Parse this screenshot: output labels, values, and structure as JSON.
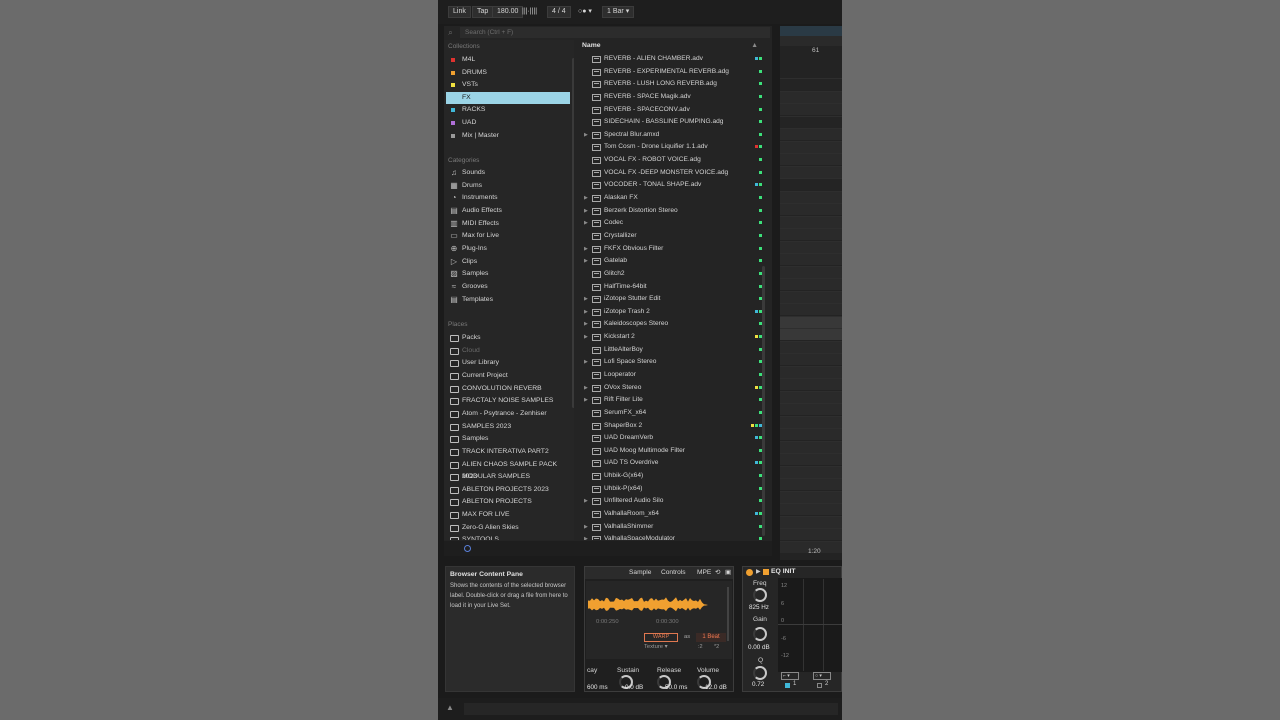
{
  "transport": {
    "link": "Link",
    "tap": "Tap",
    "tempo": "180.00",
    "time_sig": "4 / 4",
    "quantize": "1 Bar"
  },
  "browser": {
    "search_placeholder": "Search (Ctrl + F)",
    "collections_title": "Collections",
    "collections": [
      {
        "label": "M4L",
        "color": "#e0322f"
      },
      {
        "label": "DRUMS",
        "color": "#f0a030"
      },
      {
        "label": "VSTs",
        "color": "#f0e040"
      },
      {
        "label": "FX",
        "color": "#9bd4e6",
        "selected": true
      },
      {
        "label": "RACKS",
        "color": "#40b8d8"
      },
      {
        "label": "UAD",
        "color": "#b070d8"
      },
      {
        "label": "Mix | Master",
        "color": "#9a9a9a"
      }
    ],
    "categories_title": "Categories",
    "categories": [
      {
        "label": "Sounds",
        "icon": "music-note-icon",
        "glyph": "♫"
      },
      {
        "label": "Drums",
        "icon": "drum-grid-icon",
        "glyph": "▦"
      },
      {
        "label": "Instruments",
        "icon": "clock-icon",
        "glyph": "◔"
      },
      {
        "label": "Audio Effects",
        "icon": "audio-effects-icon",
        "glyph": "▤"
      },
      {
        "label": "MIDI Effects",
        "icon": "midi-effects-icon",
        "glyph": "▥"
      },
      {
        "label": "Max for Live",
        "icon": "max-for-live-icon",
        "glyph": "▭"
      },
      {
        "label": "Plug-Ins",
        "icon": "plugin-icon",
        "glyph": "⊕"
      },
      {
        "label": "Clips",
        "icon": "clip-icon",
        "glyph": "▷"
      },
      {
        "label": "Samples",
        "icon": "samples-icon",
        "glyph": "▨"
      },
      {
        "label": "Grooves",
        "icon": "grooves-icon",
        "glyph": "≈"
      },
      {
        "label": "Templates",
        "icon": "templates-icon",
        "glyph": "▤"
      }
    ],
    "places_title": "Places",
    "places": [
      {
        "label": "Packs",
        "icon": "packs-icon"
      },
      {
        "label": "Cloud",
        "icon": "cloud-icon",
        "dim": true
      },
      {
        "label": "User Library",
        "icon": "folder-icon"
      },
      {
        "label": "Current Project",
        "icon": "folder-icon"
      },
      {
        "label": "CONVOLUTION REVERB",
        "icon": "folder-icon"
      },
      {
        "label": "FRACTALY NOISE SAMPLES",
        "icon": "folder-icon"
      },
      {
        "label": "Atom - Psytrance - Zenhiser",
        "icon": "folder-icon"
      },
      {
        "label": "SAMPLES 2023",
        "icon": "folder-icon"
      },
      {
        "label": "Samples",
        "icon": "folder-icon"
      },
      {
        "label": "TRACK INTERATIVA PART2",
        "icon": "folder-icon"
      },
      {
        "label": "ALIEN CHAOS SAMPLE PACK 2023",
        "icon": "folder-icon"
      },
      {
        "label": "MODULAR SAMPLES",
        "icon": "folder-icon"
      },
      {
        "label": "ABLETON PROJECTS 2023",
        "icon": "folder-icon"
      },
      {
        "label": "ABLETON PROJECTS",
        "icon": "folder-icon"
      },
      {
        "label": "MAX FOR LIVE",
        "icon": "folder-icon"
      },
      {
        "label": "Zero-G Alien Skies",
        "icon": "folder-icon"
      },
      {
        "label": "SYNTOOLS",
        "icon": "folder-icon"
      }
    ],
    "name_header": "Name",
    "items": [
      {
        "name": "REVERB - ALIEN CHAMBER.adv",
        "expand": false,
        "tags": [
          "#40b8d8",
          "#3ce07a"
        ]
      },
      {
        "name": "REVERB - EXPERIMENTAL REVERB.adg",
        "expand": false,
        "tags": [
          "#3ce07a"
        ]
      },
      {
        "name": "REVERB - LUSH LONG REVERB.adg",
        "expand": false,
        "tags": [
          "#3ce07a"
        ]
      },
      {
        "name": "REVERB - SPACE Magik.adv",
        "expand": false,
        "tags": [
          "#3ce07a"
        ]
      },
      {
        "name": "REVERB - SPACECONV.adv",
        "expand": false,
        "tags": [
          "#3ce07a"
        ]
      },
      {
        "name": "SIDECHAIN - BASSLINE PUMPING.adg",
        "expand": false,
        "tags": [
          "#3ce07a"
        ]
      },
      {
        "name": "Spectral Blur.amxd",
        "expand": true,
        "tags": [
          "#3ce07a"
        ]
      },
      {
        "name": "Tom Cosm - Drone Liquifier 1.1.adv",
        "expand": false,
        "tags": [
          "#e0322f",
          "#3ce07a"
        ]
      },
      {
        "name": "VOCAL FX - ROBOT VOICE.adg",
        "expand": false,
        "tags": [
          "#3ce07a"
        ]
      },
      {
        "name": "VOCAL FX -DEEP MONSTER VOICE.adg",
        "expand": false,
        "tags": [
          "#3ce07a"
        ]
      },
      {
        "name": "VOCODER - TONAL SHAPE.adv",
        "expand": false,
        "tags": [
          "#40b8d8",
          "#3ce07a"
        ]
      },
      {
        "name": "Alaskan FX",
        "expand": true,
        "tags": [
          "#3ce07a"
        ]
      },
      {
        "name": "Berzerk Distortion Stereo",
        "expand": true,
        "tags": [
          "#3ce07a"
        ]
      },
      {
        "name": "Codec",
        "expand": true,
        "tags": [
          "#3ce07a"
        ]
      },
      {
        "name": "Crystallizer",
        "expand": false,
        "tags": [
          "#3ce07a"
        ]
      },
      {
        "name": "FKFX Obvious Filter",
        "expand": true,
        "tags": [
          "#3ce07a"
        ]
      },
      {
        "name": "Gatelab",
        "expand": true,
        "tags": [
          "#3ce07a"
        ]
      },
      {
        "name": "Glitch2",
        "expand": false,
        "tags": [
          "#3ce07a"
        ]
      },
      {
        "name": "HalfTime-64bit",
        "expand": false,
        "tags": [
          "#3ce07a"
        ]
      },
      {
        "name": "iZotope Stutter Edit",
        "expand": true,
        "tags": [
          "#3ce07a"
        ]
      },
      {
        "name": "iZotope Trash 2",
        "expand": true,
        "tags": [
          "#40b8d8",
          "#3ce07a"
        ]
      },
      {
        "name": "Kaleidoscopes Stereo",
        "expand": true,
        "tags": [
          "#3ce07a"
        ]
      },
      {
        "name": "Kickstart 2",
        "expand": true,
        "tags": [
          "#f0e040",
          "#3ce07a"
        ]
      },
      {
        "name": "LittleAlterBoy",
        "expand": false,
        "tags": [
          "#3ce07a"
        ]
      },
      {
        "name": "Lofi Space Stereo",
        "expand": true,
        "tags": [
          "#3ce07a"
        ]
      },
      {
        "name": "Looperator",
        "expand": false,
        "tags": [
          "#3ce07a"
        ]
      },
      {
        "name": "OVox Stereo",
        "expand": true,
        "tags": [
          "#f0e040",
          "#3ce07a"
        ]
      },
      {
        "name": "Rift Filter Lite",
        "expand": true,
        "tags": [
          "#3ce07a"
        ]
      },
      {
        "name": "SerumFX_x64",
        "expand": false,
        "tags": [
          "#3ce07a"
        ]
      },
      {
        "name": "ShaperBox 2",
        "expand": false,
        "tags": [
          "#f0e040",
          "#3ce07a",
          "#40b8d8"
        ]
      },
      {
        "name": "UAD DreamVerb",
        "expand": false,
        "tags": [
          "#40b8d8",
          "#3ce07a"
        ]
      },
      {
        "name": "UAD Moog Multimode Filter",
        "expand": false,
        "tags": [
          "#3ce07a"
        ]
      },
      {
        "name": "UAD TS Overdrive",
        "expand": false,
        "tags": [
          "#40b8d8",
          "#3ce07a"
        ]
      },
      {
        "name": "Uhbik-G(x64)",
        "expand": false,
        "tags": [
          "#3ce07a"
        ]
      },
      {
        "name": "Uhbik-P(x64)",
        "expand": false,
        "tags": [
          "#3ce07a"
        ]
      },
      {
        "name": "Unfiltered Audio Silo",
        "expand": true,
        "tags": [
          "#3ce07a"
        ]
      },
      {
        "name": "ValhallaRoom_x64",
        "expand": false,
        "tags": [
          "#40b8d8",
          "#3ce07a"
        ]
      },
      {
        "name": "ValhallaShimmer",
        "expand": true,
        "tags": [
          "#3ce07a"
        ]
      },
      {
        "name": "ValhallaSpaceModulator",
        "expand": true,
        "tags": [
          "#3ce07a"
        ]
      }
    ]
  },
  "arrangement": {
    "marker_61": "61",
    "marker_120": "1:20"
  },
  "info": {
    "title": "Browser Content Pane",
    "text": "Shows the contents of the selected browser label. Double-click or drag a file from here to load it in your Live Set."
  },
  "sampler": {
    "tab_sample": "Sample",
    "tab_controls": "Controls",
    "tab_mpe": "MPE",
    "time_a": "0:00:250",
    "time_b": "0:00:300",
    "warp": "WARP",
    "as": "as",
    "beat": "1 Beat",
    "texture": "Texture",
    "half": ":2",
    "double": "*2",
    "decay_label": "cay",
    "decay_val": "600 ms",
    "sustain_label": "Sustain",
    "sustain_val": "0.0 dB",
    "release_label": "Release",
    "release_val": "50.0 ms",
    "volume_label": "Volume",
    "volume_val": "-12.0 dB"
  },
  "eq": {
    "title": "EQ INIT",
    "freq_label": "Freq",
    "freq_val": "825 Hz",
    "gain_label": "Gain",
    "gain_val": "0.00 dB",
    "q_label": "Q",
    "q_val": "0.72",
    "scale": [
      "12",
      "6",
      "0",
      "-6",
      "-12"
    ],
    "band1": "1",
    "band2": "2"
  },
  "colors": {
    "accent": "#9bd4e6",
    "waveform": "#f0a030",
    "tag_green": "#3ce07a"
  }
}
